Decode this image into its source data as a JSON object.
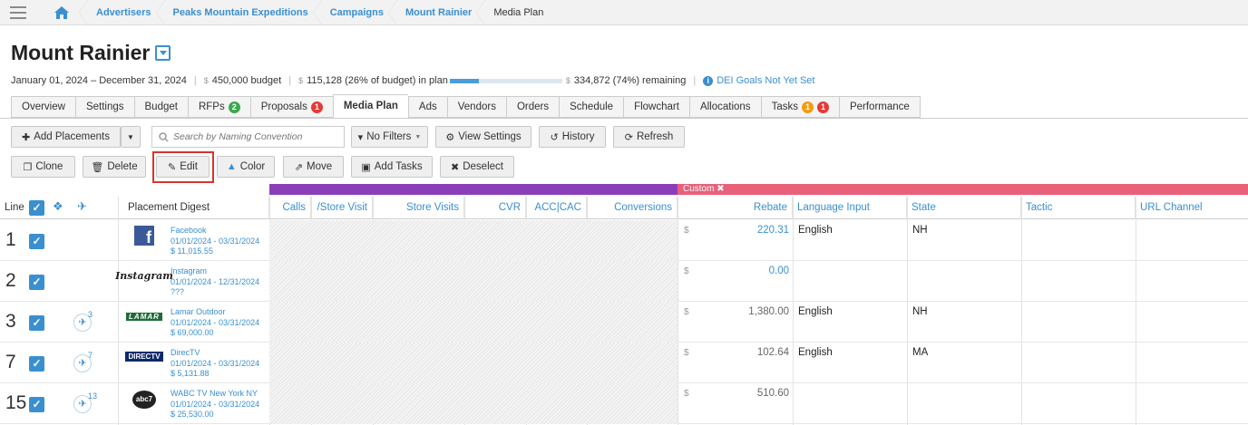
{
  "breadcrumb": {
    "items": [
      "Advertisers",
      "Peaks Mountain Expeditions",
      "Campaigns",
      "Mount Rainier"
    ],
    "current": "Media Plan"
  },
  "header": {
    "title": "Mount Rainier",
    "date_range": "January 01, 2024 – December 31, 2024",
    "currency": "$",
    "budget": "450,000 budget",
    "in_plan": "115,128 (26% of budget) in plan",
    "in_plan_fraction": 0.26,
    "remaining": "334,872 (74%) remaining",
    "dei": "DEI Goals Not Yet Set"
  },
  "tabs": [
    {
      "label": "Overview"
    },
    {
      "label": "Settings"
    },
    {
      "label": "Budget"
    },
    {
      "label": "RFPs",
      "badges": [
        {
          "text": "2",
          "color": "green"
        }
      ]
    },
    {
      "label": "Proposals",
      "badges": [
        {
          "text": "1",
          "color": "red"
        }
      ]
    },
    {
      "label": "Media Plan",
      "active": true
    },
    {
      "label": "Ads"
    },
    {
      "label": "Vendors"
    },
    {
      "label": "Orders"
    },
    {
      "label": "Schedule"
    },
    {
      "label": "Flowchart"
    },
    {
      "label": "Allocations"
    },
    {
      "label": "Tasks",
      "badges": [
        {
          "text": "1",
          "color": "orange"
        },
        {
          "text": "1",
          "color": "red"
        }
      ]
    },
    {
      "label": "Performance"
    }
  ],
  "toolbar": {
    "add_placements": "Add Placements",
    "search_placeholder": "Search by Naming Convention",
    "filters": "No Filters",
    "view_settings": "View Settings",
    "history": "History",
    "refresh": "Refresh",
    "clone": "Clone",
    "delete": "Delete",
    "edit": "Edit",
    "color": "Color",
    "move": "Move",
    "add_tasks": "Add Tasks",
    "deselect": "Deselect"
  },
  "band": {
    "custom_label": "Custom ✖"
  },
  "table": {
    "headers": {
      "line": "Line",
      "placement_digest": "Placement Digest",
      "calls": "Calls",
      "store_visit": "/Store Visit",
      "store_visits": "Store Visits",
      "cvr": "CVR",
      "acc_cac": "ACC|CAC",
      "conversions": "Conversions",
      "rebate": "Rebate",
      "language_input": "Language Input",
      "state": "State",
      "tactic": "Tactic",
      "url_channel": "URL Channel"
    },
    "rows": [
      {
        "line": "1",
        "name": "Facebook",
        "dates": "01/01/2024 - 03/31/2024",
        "cost": "$ 11,015.55",
        "currency": "$",
        "rebate": "220.31",
        "rebate_link": true,
        "language": "English",
        "state": "NH",
        "flight": "",
        "logo": "facebook-logo"
      },
      {
        "line": "2",
        "name": "Instagram",
        "dates": "01/01/2024 - 12/31/2024",
        "cost": "???",
        "currency": "$",
        "rebate": "0.00",
        "rebate_link": true,
        "language": "",
        "state": "",
        "flight": "",
        "logo": "instagram-logo",
        "logo_text": "Instagram"
      },
      {
        "line": "3",
        "name": "Lamar Outdoor",
        "dates": "01/01/2024 - 03/31/2024",
        "cost": "$ 69,000.00",
        "currency": "$",
        "rebate": "1,380.00",
        "rebate_link": false,
        "language": "English",
        "state": "NH",
        "flight": "3",
        "logo": "lamar-logo",
        "logo_text": "LAMAR"
      },
      {
        "line": "7",
        "name": "DirecTV",
        "dates": "01/01/2024 - 03/31/2024",
        "cost": "$ 5,131.88",
        "currency": "$",
        "rebate": "102.64",
        "rebate_link": false,
        "language": "English",
        "state": "MA",
        "flight": "7",
        "logo": "directv-logo",
        "logo_text": "DIRECTV"
      },
      {
        "line": "15",
        "name": "WABC TV New York NY",
        "dates": "01/01/2024 - 03/31/2024",
        "cost": "$ 25,530.00",
        "currency": "$",
        "rebate": "510.60",
        "rebate_link": false,
        "language": "",
        "state": "",
        "flight": "13",
        "logo": "abc7-logo",
        "logo_text": "abc7"
      }
    ]
  },
  "colors": {
    "accent": "#3a8fd0",
    "band_purple": "#8a3fb8",
    "band_pink": "#e8607a",
    "highlight": "#d9342b"
  }
}
